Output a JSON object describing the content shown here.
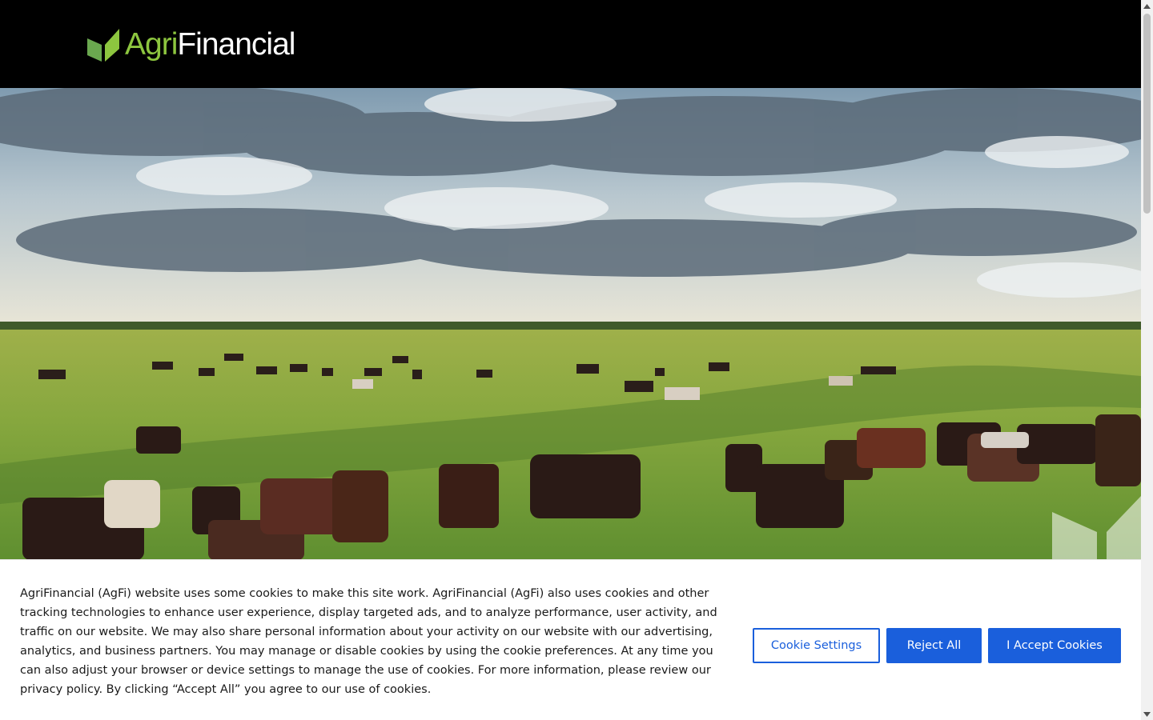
{
  "header": {
    "logo_agri": "Agri",
    "logo_financial": "Financial"
  },
  "hero": {
    "description_icon": "pasture-cattle-photo"
  },
  "cookie_banner": {
    "text": "AgriFinancial (AgFi) website uses some cookies to make this site work. AgriFinancial (AgFi) also uses cookies and other tracking technologies to enhance user experience, display targeted ads, and to analyze performance, user activity, and traffic on our website. We may also share personal information about your activity on our website with our advertising, analytics, and business partners. You may manage or disable cookies by using the cookie preferences. At any time you can also adjust your browser or device settings to manage the use of cookies. For more information, please review our privacy policy. By clicking “Accept All” you agree to our use of cookies.",
    "settings_label": "Cookie Settings",
    "reject_label": "Reject All",
    "accept_label": "I Accept Cookies"
  },
  "colors": {
    "brand_green": "#8dc63f",
    "button_blue": "#1a5fdc",
    "header_bg": "#000000"
  }
}
